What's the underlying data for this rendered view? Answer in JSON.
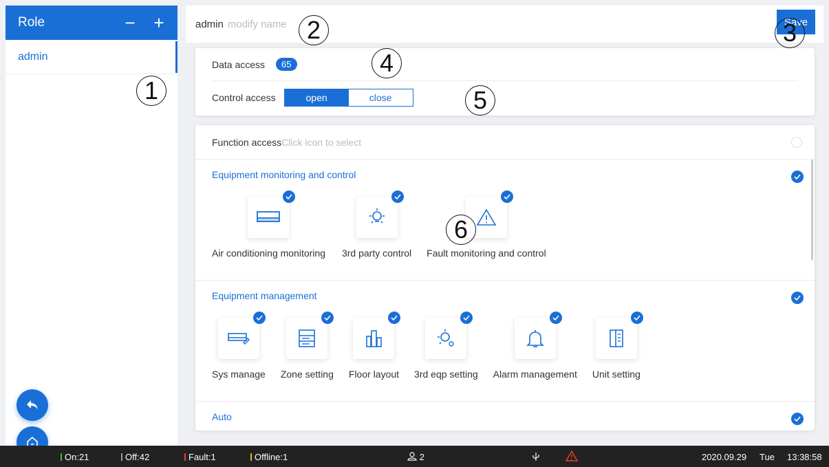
{
  "sidebar": {
    "title": "Role",
    "remove_icon": "minus-icon",
    "add_icon": "plus-icon",
    "roles": [
      {
        "label": "admin"
      }
    ]
  },
  "topbar": {
    "role_name": "admin",
    "name_placeholder": "modify name",
    "save_label": "Save"
  },
  "access": {
    "data_label": "Data access",
    "data_count": "65",
    "control_label": "Control access",
    "open_label": "open",
    "close_label": "close"
  },
  "function": {
    "title": "Function access",
    "hint": "Click icon to select",
    "groups": [
      {
        "title": "Equipment monitoring and control",
        "items": [
          {
            "label": "Air conditioning monitoring",
            "icon": "air-conditioner-icon"
          },
          {
            "label": "3rd party control",
            "icon": "bulb-icon"
          },
          {
            "label": "Fault monitoring and control",
            "icon": "warning-triangle-icon"
          }
        ]
      },
      {
        "title": "Equipment management",
        "items": [
          {
            "label": "Sys manage",
            "icon": "sys-manage-icon"
          },
          {
            "label": "Zone setting",
            "icon": "zone-icon"
          },
          {
            "label": "Floor layout",
            "icon": "building-icon"
          },
          {
            "label": "3rd eqp setting",
            "icon": "bulb-gear-icon"
          },
          {
            "label": "Alarm management",
            "icon": "bell-icon"
          },
          {
            "label": "Unit setting",
            "icon": "unit-icon"
          }
        ]
      },
      {
        "title": "Auto",
        "items": []
      }
    ]
  },
  "annotations": [
    "1",
    "2",
    "3",
    "4",
    "5",
    "6"
  ],
  "status": {
    "on": "On:21",
    "off": "Off:42",
    "fault": "Fault:1",
    "offline": "Offline:1",
    "users": "2",
    "date": "2020.09.29",
    "weekday": "Tue",
    "time": "13:38:58",
    "colors": {
      "on": "#3fbf3f",
      "off": "#9a9a9a",
      "fault": "#e2452b",
      "offline": "#e8b62a"
    }
  },
  "colors": {
    "accent": "#1a6fd6"
  }
}
